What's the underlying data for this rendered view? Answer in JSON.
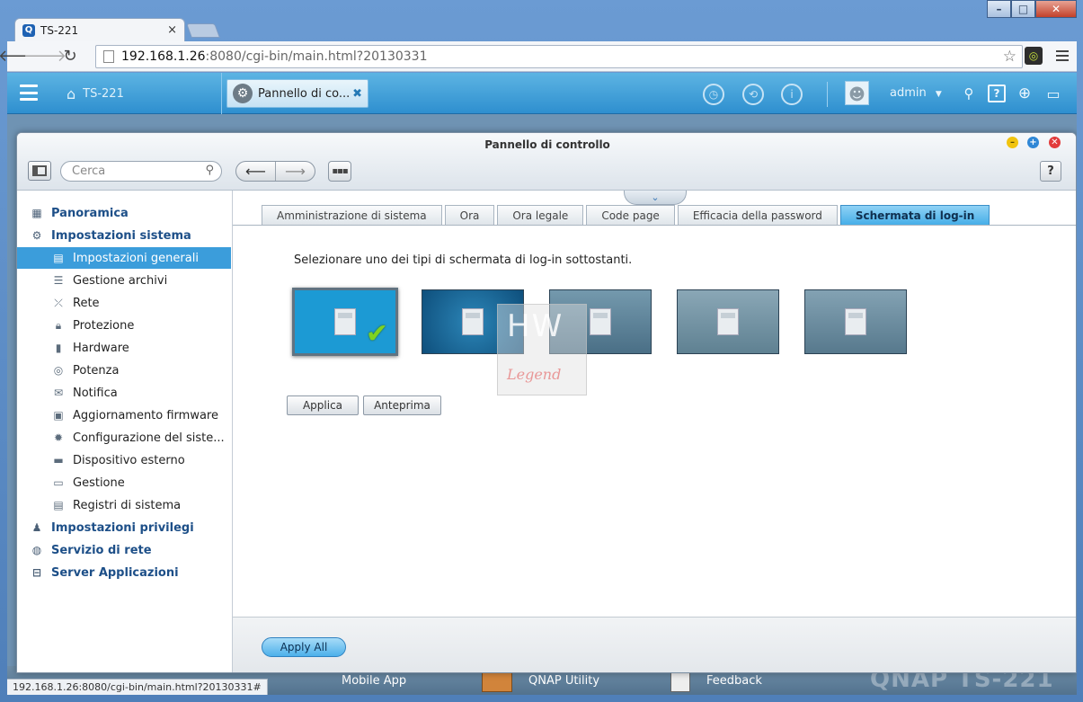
{
  "browser": {
    "tab_title": "TS-221",
    "tab_close": "×",
    "url_host": "192.168.1.26",
    "url_rest": ":8080/cgi-bin/main.html?20130331",
    "status_url": "192.168.1.26:8080/cgi-bin/main.html?20130331#"
  },
  "qnap": {
    "home_label": "TS-221",
    "task_label": "Pannello di co...",
    "user": "admin",
    "user_caret": "▼"
  },
  "desktop": {
    "items": [
      "Mobile App",
      "QNAP Utility",
      "Feedback"
    ],
    "logo": "QNAP TS-221"
  },
  "control_panel": {
    "title": "Pannello di controllo",
    "search_placeholder": "Cerca",
    "sidebar": [
      {
        "label": "Panoramica",
        "kind": "cat",
        "icon": "grid-icon"
      },
      {
        "label": "Impostazioni sistema",
        "kind": "cat",
        "icon": "gear-icon"
      },
      {
        "label": "Impostazioni generali",
        "kind": "sub",
        "icon": "settings-doc-icon",
        "active": true
      },
      {
        "label": "Gestione archivi",
        "kind": "sub",
        "icon": "disk-stack-icon"
      },
      {
        "label": "Rete",
        "kind": "sub",
        "icon": "network-icon"
      },
      {
        "label": "Protezione",
        "kind": "sub",
        "icon": "lock-icon"
      },
      {
        "label": "Hardware",
        "kind": "sub",
        "icon": "hardware-icon"
      },
      {
        "label": "Potenza",
        "kind": "sub",
        "icon": "bulb-icon"
      },
      {
        "label": "Notifica",
        "kind": "sub",
        "icon": "notification-icon"
      },
      {
        "label": "Aggiornamento firmware",
        "kind": "sub",
        "icon": "firmware-icon"
      },
      {
        "label": "Configurazione del siste...",
        "kind": "sub",
        "icon": "config-gear-icon"
      },
      {
        "label": "Dispositivo esterno",
        "kind": "sub",
        "icon": "external-device-icon"
      },
      {
        "label": "Gestione",
        "kind": "sub",
        "icon": "monitor-icon"
      },
      {
        "label": "Registri di sistema",
        "kind": "sub",
        "icon": "log-icon"
      },
      {
        "label": "Impostazioni privilegi",
        "kind": "cat",
        "icon": "user-icon"
      },
      {
        "label": "Servizio di rete",
        "kind": "cat",
        "icon": "globe-icon"
      },
      {
        "label": "Server Applicazioni",
        "kind": "cat",
        "icon": "inbox-icon"
      }
    ],
    "tabs": [
      {
        "label": "Amministrazione di sistema"
      },
      {
        "label": "Ora"
      },
      {
        "label": "Ora legale"
      },
      {
        "label": "Code page"
      },
      {
        "label": "Efficacia della password"
      },
      {
        "label": "Schermata di log-in",
        "selected": true
      }
    ],
    "instruction": "Selezionare uno dei tipi di schermata di log-in sottostanti.",
    "selected_template_index": 0,
    "buttons": {
      "apply": "Applica",
      "preview": "Anteprima",
      "apply_all": "Apply All"
    },
    "watermark": {
      "top": "HW",
      "bottom": "Legend"
    }
  }
}
